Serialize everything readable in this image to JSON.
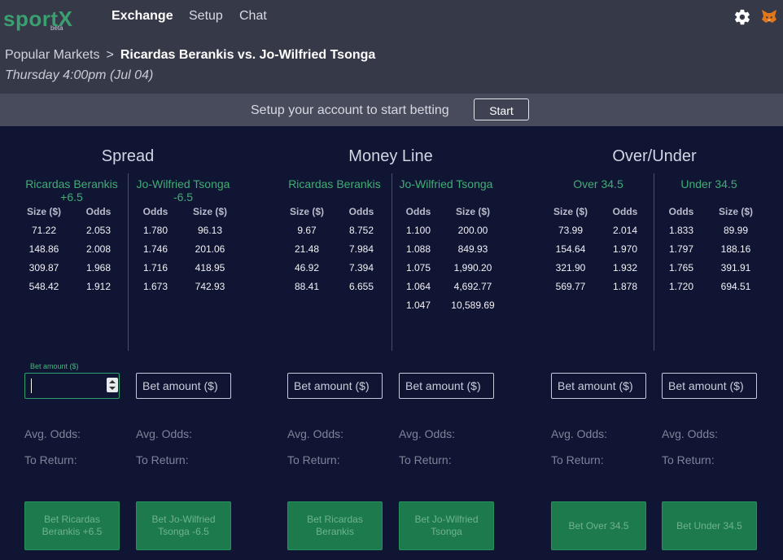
{
  "brand": {
    "name": "sportX",
    "beta": "beta"
  },
  "nav": {
    "exchange": "Exchange",
    "setup": "Setup",
    "chat": "Chat"
  },
  "breadcrumb": {
    "parent": "Popular Markets",
    "separator": ">",
    "current": "Ricardas Berankis vs. Jo-Wilfried Tsonga"
  },
  "event_time": "Thursday 4:00pm (Jul 04)",
  "banner": {
    "message": "Setup your account to start betting",
    "button": "Start"
  },
  "sections": {
    "spread": "Spread",
    "moneyline": "Money Line",
    "overunder": "Over/Under"
  },
  "columns": [
    {
      "title_line1": "Ricardas Berankis",
      "title_line2": "+6.5",
      "h1": "Size ($)",
      "h2": "Odds",
      "rows": [
        [
          "71.22",
          "2.053"
        ],
        [
          "148.86",
          "2.008"
        ],
        [
          "309.87",
          "1.968"
        ],
        [
          "548.42",
          "1.912"
        ]
      ],
      "button": "Bet Ricardas Berankis +6.5"
    },
    {
      "title_line1": "Jo-Wilfried Tsonga",
      "title_line2": "-6.5",
      "h1": "Odds",
      "h2": "Size ($)",
      "rows": [
        [
          "1.780",
          "96.13"
        ],
        [
          "1.746",
          "201.06"
        ],
        [
          "1.716",
          "418.95"
        ],
        [
          "1.673",
          "742.93"
        ]
      ],
      "button": "Bet Jo-Wilfried Tsonga -6.5"
    },
    {
      "title_line1": "Ricardas Berankis",
      "title_line2": "",
      "h1": "Size ($)",
      "h2": "Odds",
      "rows": [
        [
          "9.67",
          "8.752"
        ],
        [
          "21.48",
          "7.984"
        ],
        [
          "46.92",
          "7.394"
        ],
        [
          "88.41",
          "6.655"
        ]
      ],
      "button": "Bet Ricardas Berankis"
    },
    {
      "title_line1": "Jo-Wilfried Tsonga",
      "title_line2": "",
      "h1": "Odds",
      "h2": "Size ($)",
      "rows": [
        [
          "1.100",
          "200.00"
        ],
        [
          "1.088",
          "849.93"
        ],
        [
          "1.075",
          "1,990.20"
        ],
        [
          "1.064",
          "4,692.77"
        ],
        [
          "1.047",
          "10,589.69"
        ]
      ],
      "button": "Bet Jo-Wilfried Tsonga"
    },
    {
      "title_line1": "Over 34.5",
      "title_line2": "",
      "h1": "Size ($)",
      "h2": "Odds",
      "rows": [
        [
          "73.99",
          "2.014"
        ],
        [
          "154.64",
          "1.970"
        ],
        [
          "321.90",
          "1.932"
        ],
        [
          "569.77",
          "1.878"
        ]
      ],
      "button": "Bet Over 34.5"
    },
    {
      "title_line1": "Under 34.5",
      "title_line2": "",
      "h1": "Odds",
      "h2": "Size ($)",
      "rows": [
        [
          "1.833",
          "89.99"
        ],
        [
          "1.797",
          "188.16"
        ],
        [
          "1.765",
          "391.91"
        ],
        [
          "1.720",
          "694.51"
        ]
      ],
      "button": "Bet Under 34.5"
    }
  ],
  "bet_input": {
    "floating_label": "Bet amount ($)",
    "placeholder": "Bet amount ($)"
  },
  "avg_odds_label": "Avg. Odds:",
  "to_return_label": "To Return:",
  "colors": {
    "accent_green": "#3fae74",
    "button_green": "#1c7a4c",
    "background": "#111534",
    "topbar": "#363948"
  }
}
